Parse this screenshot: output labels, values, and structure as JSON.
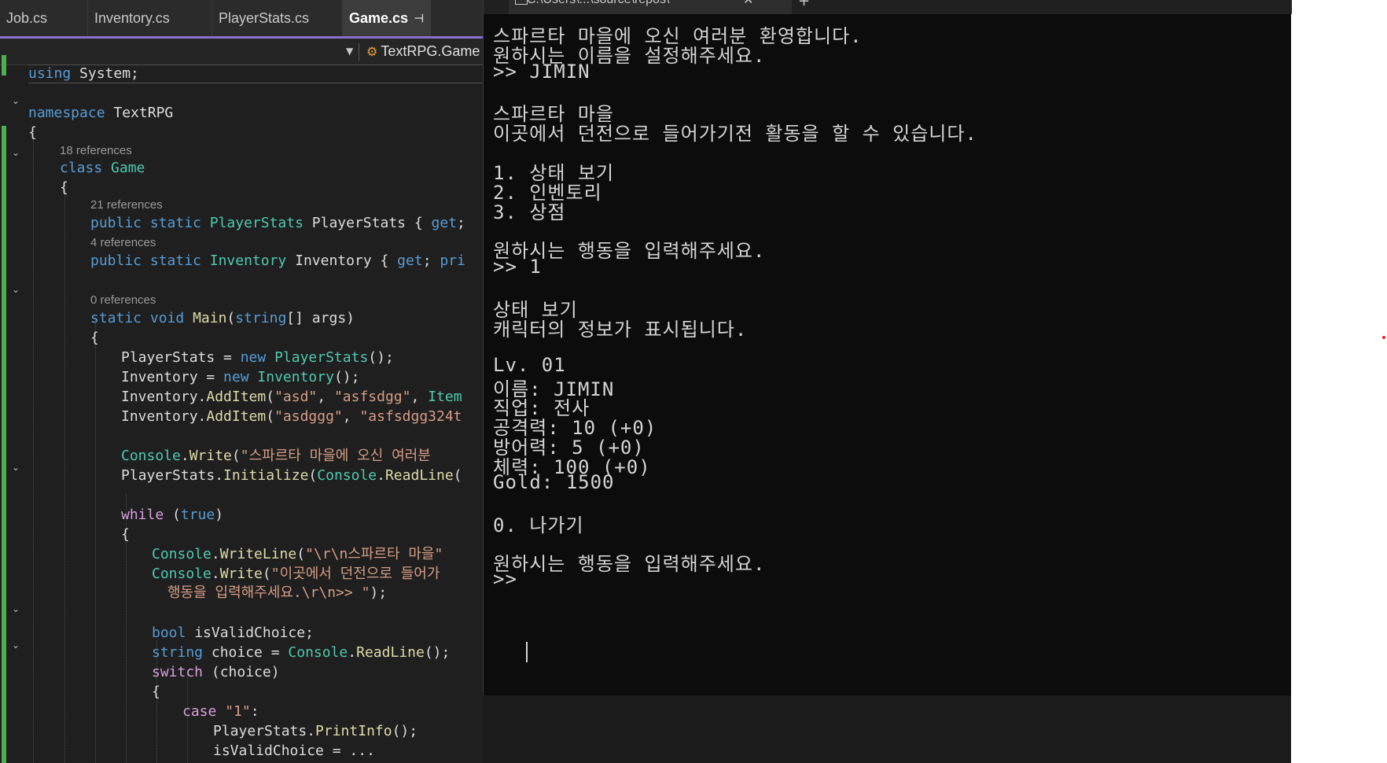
{
  "editor": {
    "tabs": [
      {
        "label": "Job.cs",
        "active": false
      },
      {
        "label": "Inventory.cs",
        "active": false
      },
      {
        "label": "PlayerStats.cs",
        "active": false
      },
      {
        "label": "Game.cs",
        "active": true
      }
    ],
    "pin_icon": "pin-icon",
    "nav_class": "TextRPG.Game",
    "references": {
      "r18": "18 references",
      "r21": "21 references",
      "r4": "4 references",
      "r0": "0 references"
    }
  },
  "console": {
    "title": "C:\\Users\\...\\source\\repos\\",
    "close": "✕",
    "new_tab": "+",
    "lines": [
      "스파르타 마을에 오신 여러분 환영합니다.",
      "원하시는 이름을 설정해주세요.",
      ">> JIMIN",
      "스파르타 마을",
      "이곳에서 던전으로 들어가기전 활동을 할 수 있습니다.",
      "1. 상태 보기",
      "2. 인벤토리",
      "3. 상점",
      "원하시는 행동을 입력해주세요.",
      ">> 1",
      "상태 보기",
      "캐릭터의 정보가 표시됩니다.",
      "Lv. 01",
      "이름: JIMIN",
      "직업: 전사",
      "공격력: 10 (+0)",
      "방어력: 5 (+0)",
      "체력: 100 (+0)",
      "Gold: 1500",
      "0. 나가기",
      "원하시는 행동을 입력해주세요.",
      ">> "
    ]
  },
  "colors": {
    "editor_bg": "#1f1f1f",
    "console_bg": "#0c0c0c",
    "keyword": "#569cd6",
    "type": "#4ec9b0",
    "string": "#d69d85",
    "change_bar": "#4caf50",
    "active_tab_underline": "#8a6fd1"
  }
}
